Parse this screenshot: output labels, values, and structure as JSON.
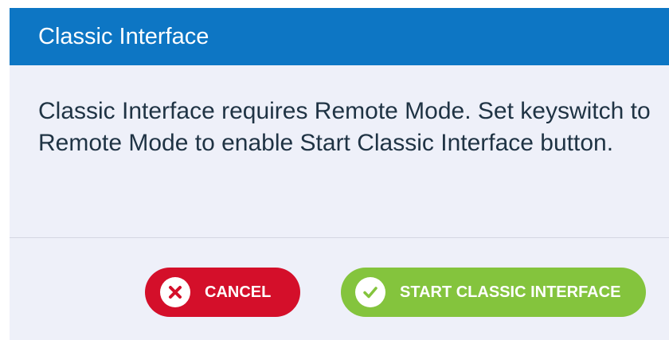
{
  "dialog": {
    "title": "Classic Interface",
    "message": "Classic Interface requires Remote Mode. Set keyswitch to Remote Mode to enable Start Classic Interface button.",
    "buttons": {
      "cancel": {
        "label": "CANCEL",
        "icon": "close-circle-icon",
        "color": "#d40f2a"
      },
      "start": {
        "label": "START CLASSIC INTERFACE",
        "icon": "check-circle-icon",
        "color": "#84c43d"
      }
    }
  },
  "colors": {
    "header": "#0d76c4",
    "body_background": "#eef0f9",
    "message_text": "#1f3344"
  }
}
